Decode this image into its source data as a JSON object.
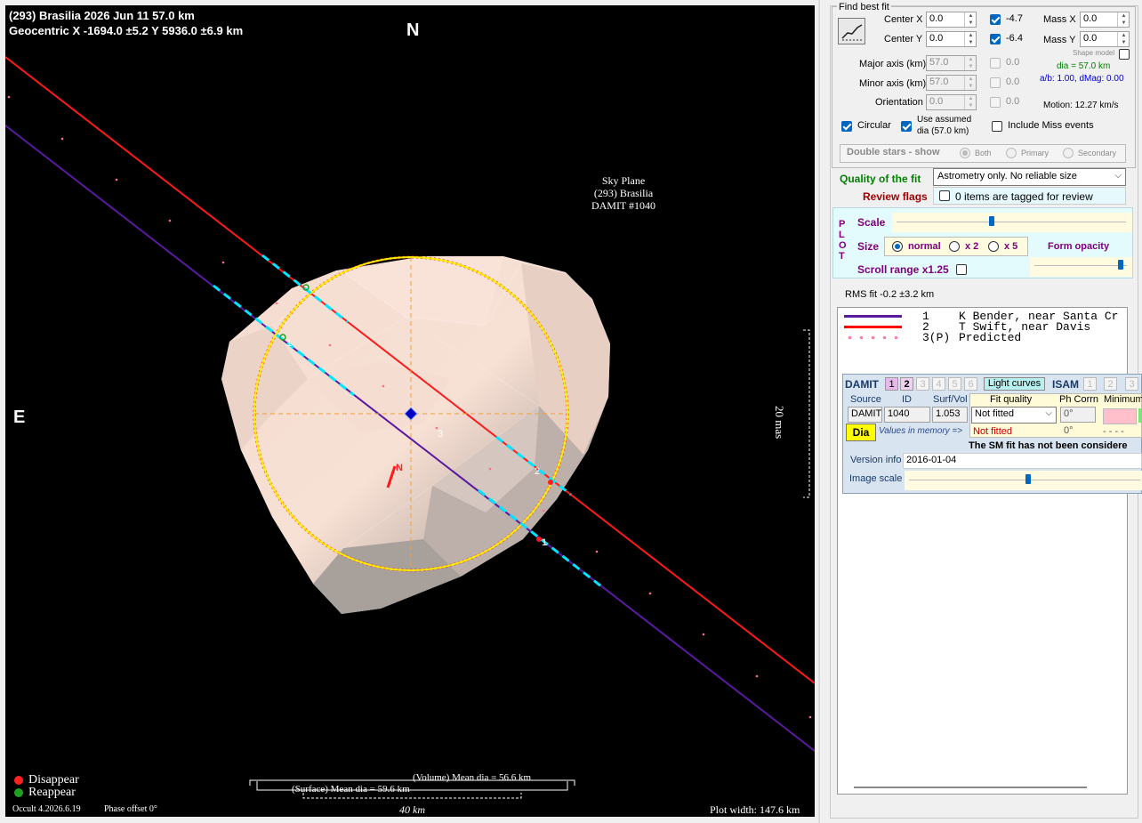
{
  "plot": {
    "title_line1": "(293) Brasilia  2026 Jun 11   57.0 km",
    "title_line2": "Geocentric  X  -1694.0 ±5.2  Y 5936.0 ±6.9 km",
    "north": "N",
    "east": "E",
    "sky_plane": [
      "Sky Plane",
      "(293) Brasilia",
      "DAMIT #1040"
    ],
    "scale_label": "20 mas",
    "legend_disappear": "Disappear",
    "legend_reappear": "Reappear",
    "version": "Occult 4.2026.6.19",
    "phase_offset": "Phase offset 0°",
    "volume_dia": "(Volume) Mean dia = 56.6 km",
    "surface_dia": "(Surface) Mean dia = 59.6 km",
    "scale_km": "40 km",
    "plot_width": "Plot width: 147.6 km",
    "chord_labels": [
      "1",
      "2",
      "3"
    ],
    "shape_north": "N",
    "colors": {
      "disappear": "#ff2020",
      "reappear": "#20a020",
      "fit_ellipse": "#ffff00",
      "chord1": "#5a1aa0",
      "chord2": "#ff0000",
      "gap": "#00e0ff"
    }
  },
  "fit": {
    "group_title": "Find best fit",
    "fit_icon": "line-fit-icon",
    "center_x_label": "Center X",
    "center_x": "0.0",
    "center_y_label": "Center Y",
    "center_y": "0.0",
    "center_x_adj": "-4.7",
    "center_y_adj": "-6.4",
    "mass_x_label": "Mass X",
    "mass_x": "0.0",
    "mass_y_label": "Mass Y",
    "mass_y": "0.0",
    "shape_model": "Shape model",
    "major_label": "Major axis (km)",
    "major": "57.0",
    "major_adj": "0.0",
    "minor_label": "Minor axis (km)",
    "minor": "57.0",
    "minor_adj": "0.0",
    "orient_label": "Orientation",
    "orient": "0.0",
    "orient_adj": "0.0",
    "dia_text": "dia = 57.0 km",
    "ab_text": "a/b: 1.00, dMag: 0.00",
    "motion": "Motion: 12.27 km/s",
    "circular": "Circular",
    "use_assumed": "Use assumed",
    "use_assumed2": "dia (57.0 km)",
    "include_miss": "Include Miss events"
  },
  "double_stars": {
    "label": "Double stars - show",
    "both": "Both",
    "primary": "Primary",
    "secondary": "Secondary"
  },
  "quality": {
    "label": "Quality of the fit",
    "value": "Astrometry only. No reliable size",
    "review_label": "Review flags",
    "review_value": "0 items are tagged for review"
  },
  "plotopts": {
    "side": [
      "P",
      "L",
      "O",
      "T"
    ],
    "scale": "Scale",
    "size": "Size",
    "normal": "normal",
    "x2": "x 2",
    "x5": "x 5",
    "form_opacity": "Form opacity",
    "scroll": "Scroll range x1.25"
  },
  "rms": "RMS fit -0.2 ±3.2 km",
  "observers": [
    {
      "num": "1",
      "name": "K Bender, near Santa Cr",
      "color": "#5a1aa0"
    },
    {
      "num": "2",
      "name": "T Swift, near Davis",
      "color": "#ff0000"
    },
    {
      "num": "3(P)",
      "name": "Predicted",
      "color": "#ff7a9a"
    }
  ],
  "damit": {
    "label": "DAMIT",
    "tabs": [
      "1",
      "2",
      "3",
      "4",
      "5",
      "6"
    ],
    "light_curves": "Light curves",
    "isam": "ISAM",
    "isam_tabs": [
      "1",
      "2",
      "3"
    ],
    "h_source": "Source",
    "h_id": "ID",
    "h_surfvol": "Surf/Vol",
    "h_fitq": "Fit quality",
    "h_phcorr": "Ph Corrn",
    "h_min": "Minimum",
    "source": "DAMIT",
    "id": "1040",
    "surfvol": "1.053",
    "fitq": "Not fitted",
    "phcorr": "0°",
    "dia_btn": "Dia",
    "values_memory": "Values in memory =>",
    "fitq2": "Not fitted",
    "phcorr2": "0°",
    "min2": "- - - -",
    "sm_note": "The SM fit has not been considere",
    "version_label": "Version info",
    "version": "2016-01-04",
    "image_scale": "Image scale"
  }
}
